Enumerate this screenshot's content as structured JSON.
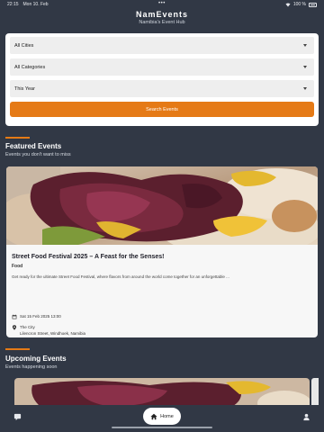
{
  "status_bar": {
    "time": "22:15",
    "date": "Mon 10. Feb",
    "dots": "•••",
    "battery": "100 %"
  },
  "header": {
    "title": "NamEvents",
    "subtitle": "Namibia's Event Hub"
  },
  "filters": {
    "city": "All Cities",
    "category": "All Categories",
    "period": "This Year",
    "search_label": "Search Events"
  },
  "featured": {
    "title": "Featured Events",
    "subtitle": "Events you don't want to miss",
    "event": {
      "title": "Street Food Festival 2025 – A Feast for the Senses!",
      "category": "Food",
      "description": "Get ready for the ultimate Street Food Festival, where flavors from around the world come together for an unforgettable ...",
      "datetime": "Sat 15 Feb 2025 13:00",
      "venue": "The City",
      "address": "Lilencron Street, Windhoek, Namibia"
    }
  },
  "upcoming": {
    "title": "Upcoming Events",
    "subtitle": "Events happening soon"
  },
  "nav": {
    "home_label": "Home"
  },
  "colors": {
    "background": "#313845",
    "accent": "#e57a16",
    "card": "#f7f7f7"
  }
}
